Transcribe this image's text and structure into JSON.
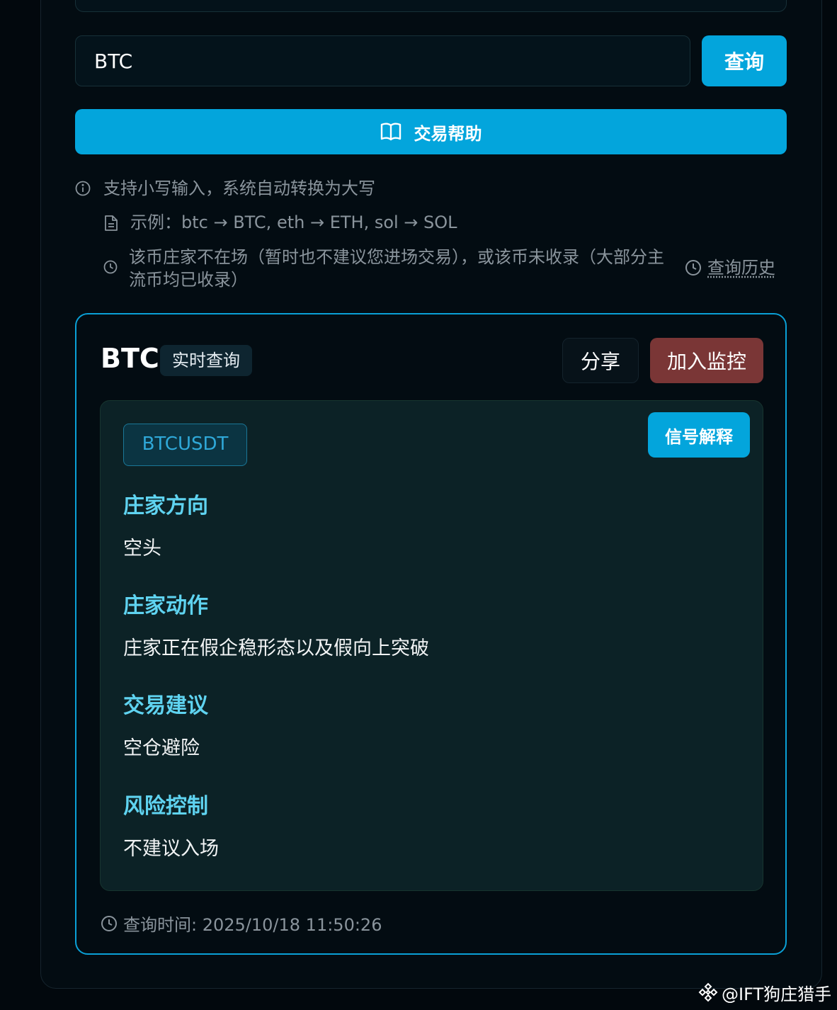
{
  "search": {
    "value": "BTC",
    "query_button": "查询",
    "help_button": "交易帮助"
  },
  "hints": {
    "lowercase": "支持小写输入，系统自动转换为大写",
    "example": "示例：btc → BTC, eth → ETH, sol → SOL",
    "not_listed": "该币庄家不在场（暂时也不建议您进场交易），或该币未收录（大部分主流币均已收录）",
    "history_link": "查询历史"
  },
  "result": {
    "symbol": "BTC",
    "badge": "实时查询",
    "share_button": "分享",
    "monitor_button": "加入监控",
    "pair": "BTCUSDT",
    "explain_button": "信号解释",
    "sections": [
      {
        "title": "庄家方向",
        "body": "空头"
      },
      {
        "title": "庄家动作",
        "body": "庄家正在假企稳形态以及假向上突破"
      },
      {
        "title": "交易建议",
        "body": "空仓避险"
      },
      {
        "title": "风险控制",
        "body": "不建议入场"
      }
    ],
    "query_time": "查询时间: 2025/10/18 11:50:26"
  },
  "watermark": "@IFT狗庄猎手",
  "colors": {
    "accent": "#03a5dc",
    "danger": "#7a3636",
    "section_title": "#5fd3f0"
  }
}
